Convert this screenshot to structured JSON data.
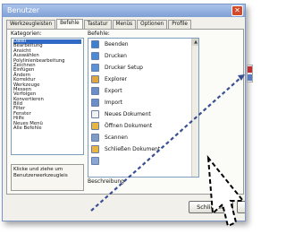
{
  "window": {
    "title": "Benutzer",
    "close_glyph": "✕"
  },
  "tabs": [
    {
      "label": "Werkzeugleisten"
    },
    {
      "label": "Befehle",
      "active": true
    },
    {
      "label": "Tastatur"
    },
    {
      "label": "Menüs"
    },
    {
      "label": "Optionen"
    },
    {
      "label": "Profile"
    }
  ],
  "categories_label": "Kategorien:",
  "categories": [
    "Datei",
    "Bearbeitung",
    "Ansicht",
    "Auswählen",
    "Polylinienbearbeitung",
    "Zeichnen",
    "Einfügen",
    "Ändern",
    "Korrektur",
    "Werkzeuge",
    "Messen",
    "Verfolgen",
    "Konvertieren",
    "Bild",
    "Filter",
    "Fenster",
    "Hilfe",
    "Neues Menü",
    "Alle Befehle"
  ],
  "selected_category": "Datei",
  "commands_label": "Befehle:",
  "commands": [
    {
      "label": "Beenden",
      "color": "#3f7fd0"
    },
    {
      "label": "Drucken",
      "color": "#4c8ad6"
    },
    {
      "label": "Drucker Setup",
      "color": "#5a92d8"
    },
    {
      "label": "Explorer",
      "color": "#e2a53a"
    },
    {
      "label": "Export",
      "color": "#6a8fc8"
    },
    {
      "label": "Import",
      "color": "#6a8fc8"
    },
    {
      "label": "Neues Dokument",
      "color": "#f2f2f2"
    },
    {
      "label": "Öffnen Dokument",
      "color": "#e8b640"
    },
    {
      "label": "Scannen",
      "color": "#7f9cc7"
    },
    {
      "label": "Schließen Dokument",
      "color": "#e8b640"
    },
    {
      "label": "",
      "color": "#8aa6d4"
    }
  ],
  "description_label": "Beschreibung",
  "hint_text": [
    "Klicke und ziehe um",
    "Benutzerwerkzeugleis"
  ],
  "buttons": {
    "close": "Schließen"
  }
}
